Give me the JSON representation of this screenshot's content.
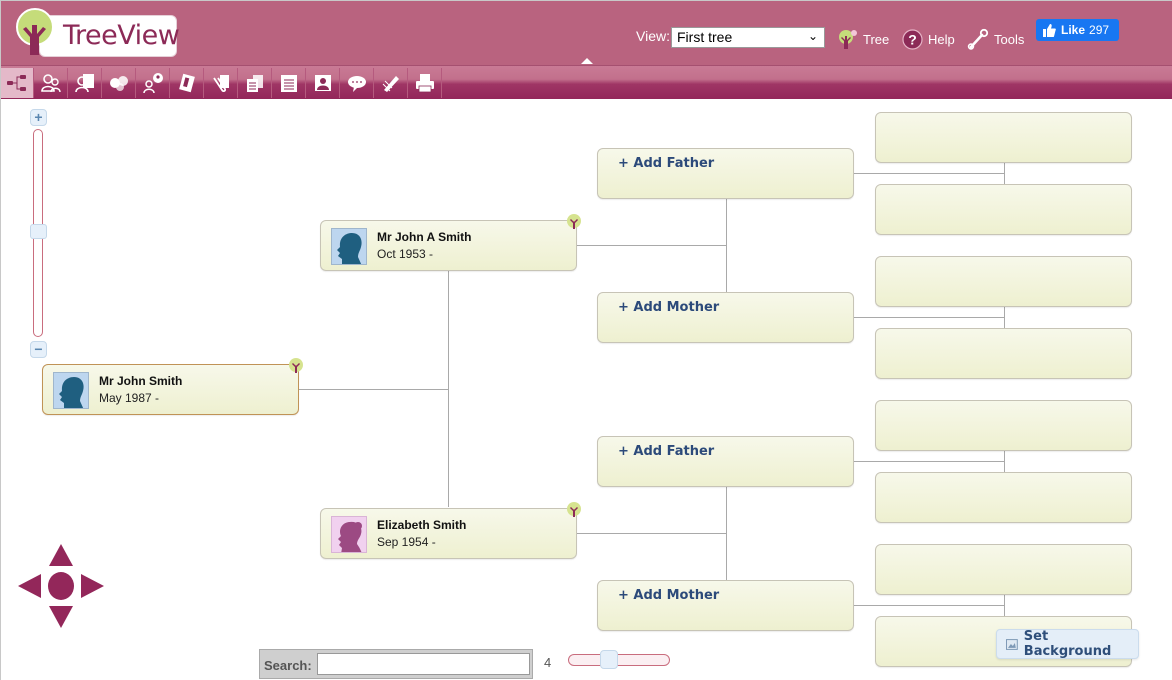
{
  "app": {
    "title": "TreeView",
    "logo_text_a": "Tree",
    "logo_text_b": "View"
  },
  "header": {
    "view_label": "View:",
    "view_selected": "First tree",
    "links": [
      {
        "label": "Tree",
        "icon": "tree-icon"
      },
      {
        "label": "Help",
        "icon": "help-icon"
      },
      {
        "label": "Tools",
        "icon": "wrench-icon"
      }
    ],
    "like": {
      "label": "Like",
      "count": "297"
    }
  },
  "toolbar": {
    "buttons": [
      {
        "name": "tree-chart",
        "icon": "tree-chart-icon",
        "active": true
      },
      {
        "name": "people",
        "icon": "people-icon"
      },
      {
        "name": "person-details",
        "icon": "person-card-icon"
      },
      {
        "name": "families",
        "icon": "families-icon"
      },
      {
        "name": "add-person",
        "icon": "add-person-icon"
      },
      {
        "name": "media",
        "icon": "media-icon"
      },
      {
        "name": "attachments",
        "icon": "paperclip-icon"
      },
      {
        "name": "documents",
        "icon": "documents-icon"
      },
      {
        "name": "notes",
        "icon": "notepad-icon"
      },
      {
        "name": "portrait",
        "icon": "portrait-icon"
      },
      {
        "name": "comments",
        "icon": "speech-bubble-icon"
      },
      {
        "name": "edit",
        "icon": "pen-icon"
      },
      {
        "name": "print",
        "icon": "printer-icon"
      }
    ]
  },
  "tree": {
    "root": {
      "name": "Mr John Smith",
      "dates": "May 1987 -",
      "gender": "male"
    },
    "father": {
      "name": "Mr John A Smith",
      "dates": "Oct 1953 -",
      "gender": "male"
    },
    "mother": {
      "name": "Elizabeth Smith",
      "dates": "Sep 1954 -",
      "gender": "female"
    },
    "grandparents": [
      {
        "label": "+ Add Father"
      },
      {
        "label": "+ Add Mother"
      },
      {
        "label": "+ Add Father"
      },
      {
        "label": "+ Add Mother"
      }
    ],
    "great_grandparent_slots": 8
  },
  "controls": {
    "zoom_plus": "+",
    "zoom_minus": "−",
    "zoom_level_fraction": 0.55,
    "search_label": "Search:",
    "search_value": "",
    "generations": "4",
    "generations_fraction": 0.35,
    "set_background": "Set Background"
  },
  "colors": {
    "header": "#b9637f",
    "accent": "#93275a",
    "card": "#f0f2d6",
    "link_blue": "#2c4a7a",
    "facebook": "#1877f2"
  }
}
